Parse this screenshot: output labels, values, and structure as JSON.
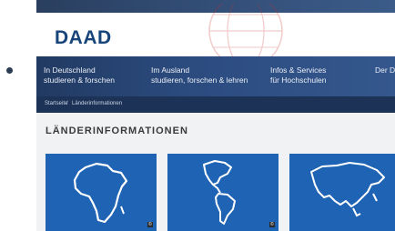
{
  "header": {
    "logo": "DAAD"
  },
  "nav": {
    "items": [
      {
        "line1": "In Deutschland",
        "line2": "studieren & forschen"
      },
      {
        "line1": "Im Ausland",
        "line2": "studieren, forschen & lehren"
      },
      {
        "line1": "Infos & Services",
        "line2": "für Hochschulen"
      },
      {
        "line1": "Der DAAD",
        "line2": ""
      }
    ]
  },
  "breadcrumb": {
    "home": "Startseite",
    "separator": "/",
    "current": "Länderinformationen"
  },
  "main": {
    "title": "LÄNDERINFORMATIONEN",
    "cards": [
      {
        "region": "africa-map-icon",
        "badge": "©"
      },
      {
        "region": "americas-map-icon",
        "badge": "©"
      },
      {
        "region": "asia-map-icon",
        "badge": ""
      }
    ]
  },
  "colors": {
    "brand": "#17457a",
    "nav": "#2c4c80",
    "card": "#1f63b4",
    "content_bg": "#f1f2f3"
  }
}
